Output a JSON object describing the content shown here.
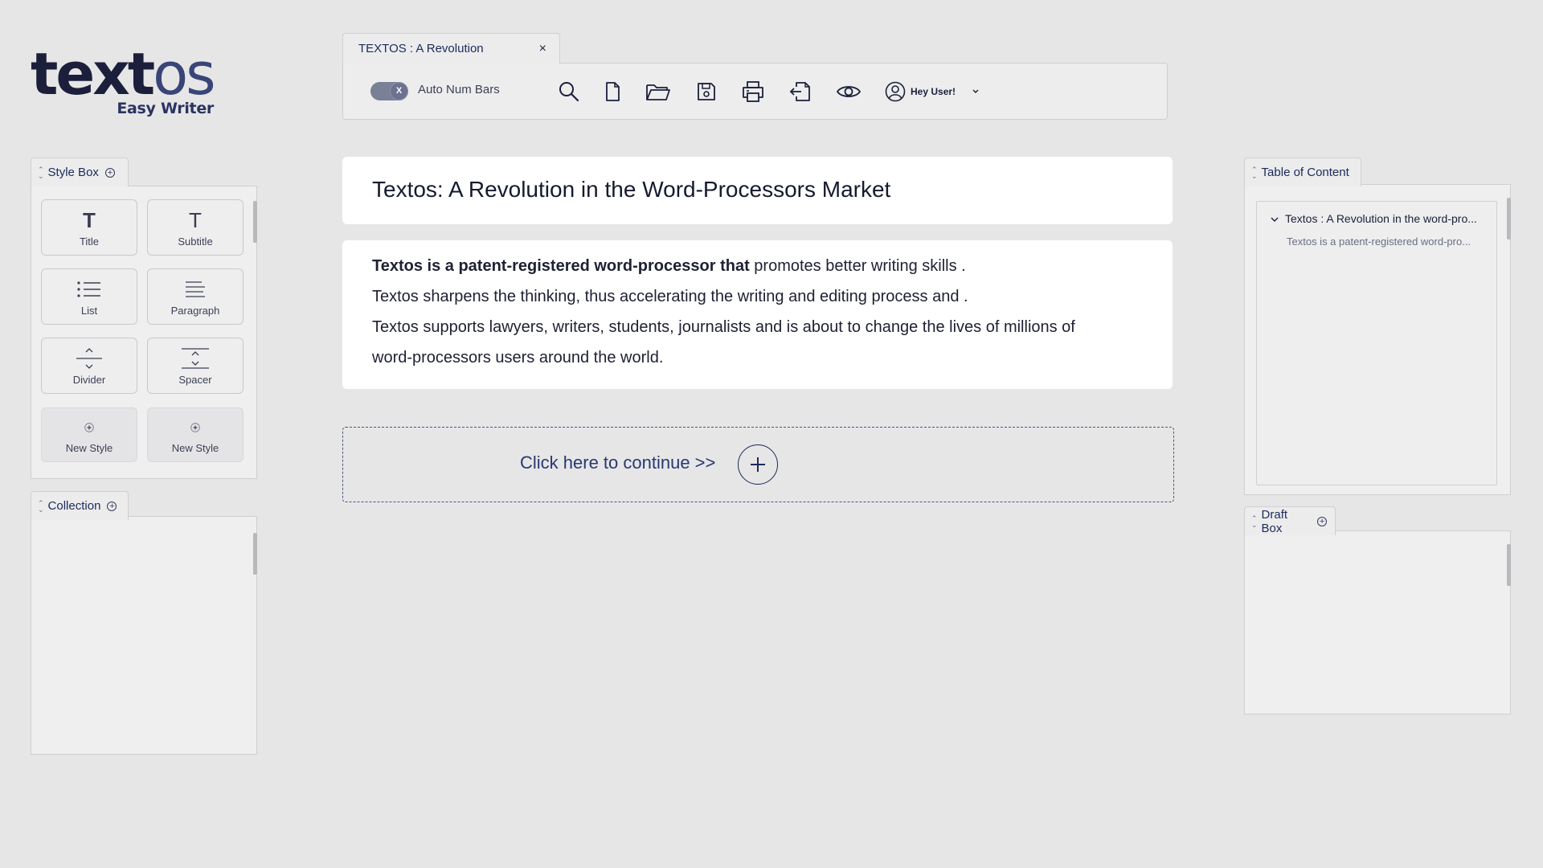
{
  "logo": {
    "word_main": "text",
    "word_accent": "os",
    "subtitle": "Easy Writer"
  },
  "style_box": {
    "title": "Style Box",
    "items": [
      {
        "label": "Title",
        "icon": "title-T-icon"
      },
      {
        "label": "Subtitle",
        "icon": "subtitle-T-icon"
      },
      {
        "label": "List",
        "icon": "list-icon"
      },
      {
        "label": "Paragraph",
        "icon": "paragraph-icon"
      },
      {
        "label": "Divider",
        "icon": "divider-icon"
      },
      {
        "label": "Spacer",
        "icon": "spacer-icon"
      },
      {
        "label": "New Style",
        "icon": "plus-icon"
      },
      {
        "label": "New Style",
        "icon": "plus-icon"
      }
    ]
  },
  "collection": {
    "title": "Collection"
  },
  "toolbar": {
    "tab_title": "TEXTOS : A Revolution",
    "close_symbol": "×",
    "toggle_knob": "X",
    "toggle_label": "Auto Num Bars",
    "user_name": "Hey User!",
    "icons": [
      "search-icon",
      "new-file-icon",
      "open-folder-icon",
      "save-icon",
      "print-icon",
      "export-icon",
      "preview-eye-icon",
      "user-icon"
    ]
  },
  "document": {
    "title": "Textos:  A Revolution in the Word-Processors Market",
    "p1_bold": "Textos is a patent-registered word-processor that",
    "p1_rest": " promotes better writing skills .",
    "p2": "Textos sharpens the thinking, thus accelerating the writing and editing process and .",
    "p3": "Textos supports lawyers, writers, students, journalists and is about to change the lives of millions of",
    "p4": "word-processors users around the world."
  },
  "continue": {
    "label": "Click here to continue >>"
  },
  "toc": {
    "title": "Table of Content",
    "item_title": "Textos : A Revolution in the word-pro...",
    "item_sub": "Textos is a patent-registered word-pro..."
  },
  "draft_box": {
    "title": "Draft Box"
  },
  "colors": {
    "background": "#e6e6e7",
    "brand_navy": "#1b1f3b",
    "accent_blue": "#2a3870",
    "panel": "#efefef"
  }
}
